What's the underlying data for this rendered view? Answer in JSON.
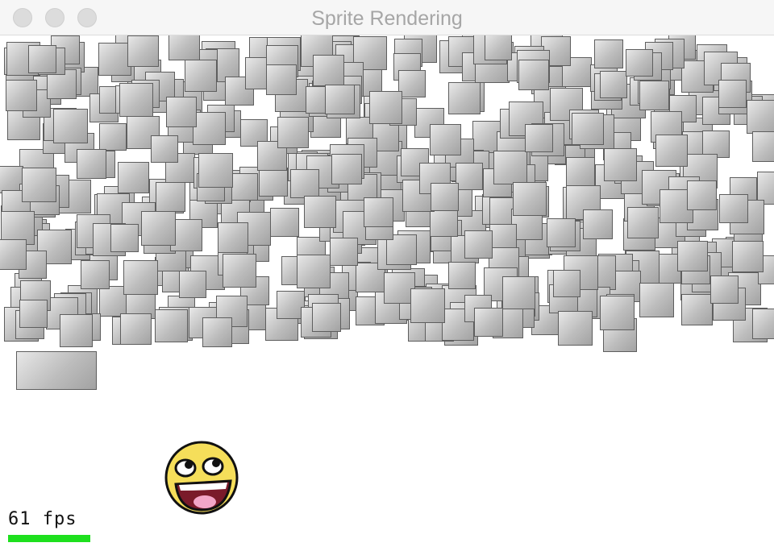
{
  "window": {
    "title": "Sprite Rendering"
  },
  "controls": {
    "close": "close",
    "minimize": "minimize",
    "zoom": "zoom"
  },
  "scene": {
    "sprite_count": 460,
    "smiley": "awesome-face",
    "sprite_fill": "#bdbdbd",
    "sprite_border": "#5e5e5e"
  },
  "hud": {
    "fps_label": "61 fps",
    "fps_value": 61,
    "fps_fraction": 1.0,
    "fps_bar_color": "#1ee01e"
  },
  "colors": {
    "background": "#ffffff",
    "titlebar": "#f6f6f6",
    "title_text": "#a6a6a6"
  }
}
